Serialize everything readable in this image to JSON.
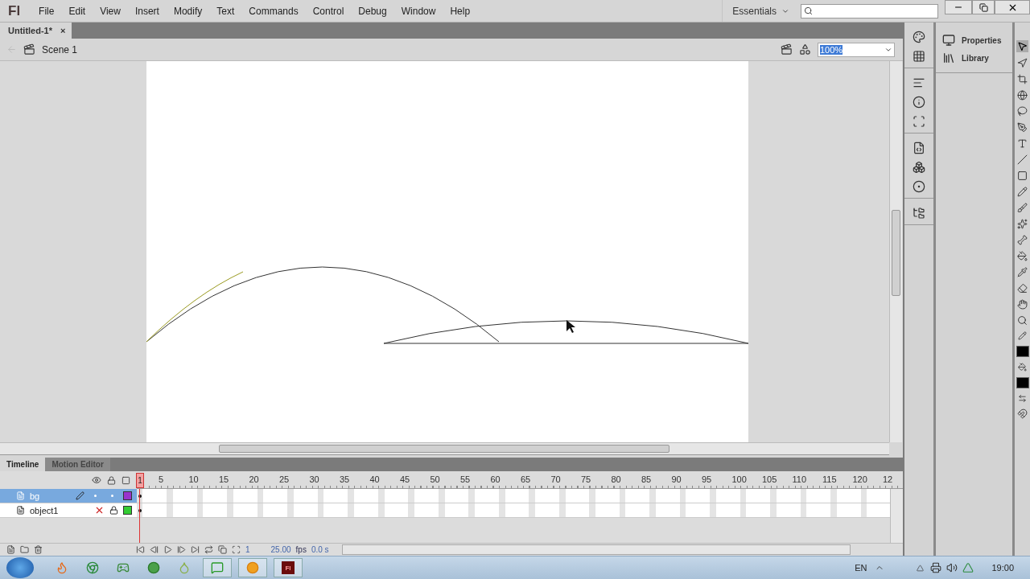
{
  "app": {
    "logo": "Fl",
    "menu": [
      "File",
      "Edit",
      "View",
      "Insert",
      "Modify",
      "Text",
      "Commands",
      "Control",
      "Debug",
      "Window",
      "Help"
    ],
    "workspace": "Essentials"
  },
  "document_tabs": [
    {
      "label": "Untitled-1*",
      "close": "×",
      "selected": true
    }
  ],
  "edit_bar": {
    "scene": "Scene 1",
    "zoom": "100%"
  },
  "panels": [
    {
      "label": "Properties"
    },
    {
      "label": "Library"
    }
  ],
  "timeline": {
    "tabs": [
      {
        "label": "Timeline",
        "selected": true
      },
      {
        "label": "Motion Editor",
        "selected": false
      }
    ],
    "ruler": [
      "1",
      "5",
      "10",
      "15",
      "20",
      "25",
      "30",
      "35",
      "40",
      "45",
      "50",
      "55",
      "60",
      "65",
      "70",
      "75",
      "80",
      "85",
      "90",
      "95",
      "100",
      "105",
      "110",
      "115",
      "120",
      "12"
    ],
    "layers": [
      {
        "name": "bg",
        "selected": true,
        "visible": true,
        "locked": false,
        "color": "#9933cc"
      },
      {
        "name": "object1",
        "selected": false,
        "visible": false,
        "locked": true,
        "color": "#33cc33"
      }
    ],
    "current_frame": "1",
    "frame_rate": "25.00",
    "fps_unit": "fps",
    "elapsed": "0.0 s"
  },
  "taskbar": {
    "flash_label": "Fl",
    "language": "EN",
    "time": "19:00"
  }
}
